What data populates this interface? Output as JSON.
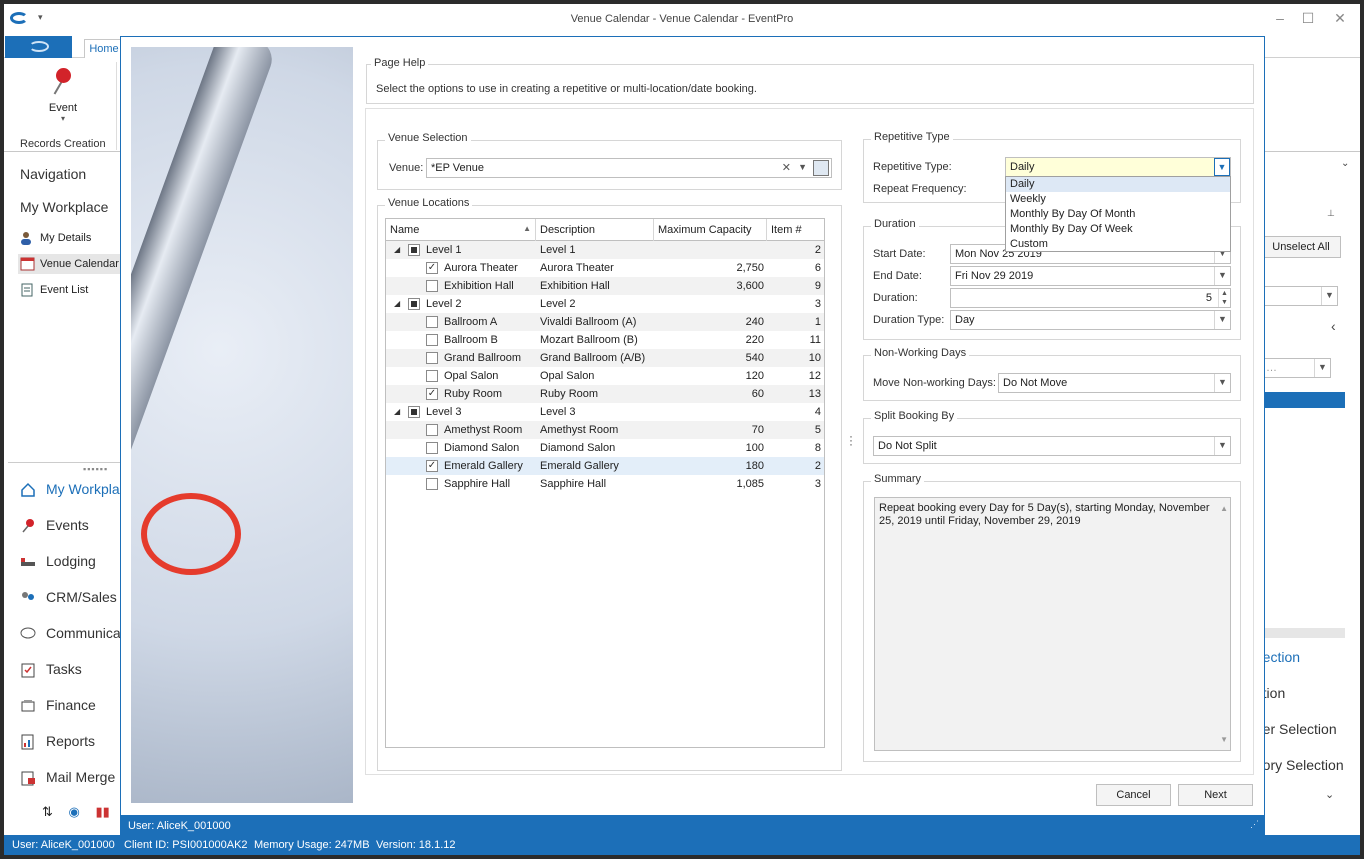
{
  "window": {
    "title": "Venue Calendar - Venue Calendar - EventPro"
  },
  "ribbon": {
    "tabs": [
      "Home"
    ],
    "event_label": "Event",
    "group_label": "Records Creation"
  },
  "nav": {
    "navigation_header": "Navigation",
    "workplace_header": "My Workplace",
    "items": [
      "My Details",
      "Venue Calendar",
      "Event List"
    ],
    "modules": [
      "My Workplace",
      "Events",
      "Lodging",
      "CRM/Sales",
      "Communications",
      "Tasks",
      "Finance",
      "Reports",
      "Mail Merge"
    ]
  },
  "right_panel": {
    "unselect_all": "Unselect All",
    "items": [
      "...ection",
      "...tion",
      "...er Selection",
      "...ory Selection"
    ]
  },
  "status": {
    "user": "User: AliceK_001000",
    "client": "Client ID: PSI001000AK2",
    "memory": "Memory Usage: 247MB",
    "version": "Version: 18.1.12"
  },
  "dialog": {
    "status_user": "User: AliceK_001000",
    "page_help": {
      "title": "Page Help",
      "text": "Select the options to use in creating a repetitive or multi-location/date booking."
    },
    "venue_selection": {
      "title": "Venue Selection",
      "venue_label": "Venue:",
      "venue_value": "*EP Venue"
    },
    "venue_locations": {
      "title": "Venue Locations",
      "columns": [
        "Name",
        "Description",
        "Maximum Capacity",
        "Item #"
      ],
      "rows": [
        {
          "level": 0,
          "name": "Level 1",
          "desc": "Level 1",
          "cap": "",
          "item": "2",
          "check": "ind"
        },
        {
          "level": 1,
          "name": "Aurora Theater",
          "desc": "Aurora Theater",
          "cap": "2,750",
          "item": "6",
          "check": "on"
        },
        {
          "level": 1,
          "name": "Exhibition Hall",
          "desc": "Exhibition Hall",
          "cap": "3,600",
          "item": "9",
          "check": "off"
        },
        {
          "level": 0,
          "name": "Level 2",
          "desc": "Level 2",
          "cap": "",
          "item": "3",
          "check": "ind"
        },
        {
          "level": 1,
          "name": "Ballroom A",
          "desc": "Vivaldi Ballroom (A)",
          "cap": "240",
          "item": "1",
          "check": "off"
        },
        {
          "level": 1,
          "name": "Ballroom B",
          "desc": "Mozart Ballroom (B)",
          "cap": "220",
          "item": "11",
          "check": "off"
        },
        {
          "level": 1,
          "name": "Grand Ballroom",
          "desc": "Grand Ballroom (A/B)",
          "cap": "540",
          "item": "10",
          "check": "off"
        },
        {
          "level": 1,
          "name": "Opal Salon",
          "desc": "Opal Salon",
          "cap": "120",
          "item": "12",
          "check": "off"
        },
        {
          "level": 1,
          "name": "Ruby Room",
          "desc": "Ruby Room",
          "cap": "60",
          "item": "13",
          "check": "on"
        },
        {
          "level": 0,
          "name": "Level 3",
          "desc": "Level 3",
          "cap": "",
          "item": "4",
          "check": "ind"
        },
        {
          "level": 1,
          "name": "Amethyst Room",
          "desc": "Amethyst Room",
          "cap": "70",
          "item": "5",
          "check": "off"
        },
        {
          "level": 1,
          "name": "Diamond Salon",
          "desc": "Diamond Salon",
          "cap": "100",
          "item": "8",
          "check": "off"
        },
        {
          "level": 1,
          "name": "Emerald Gallery",
          "desc": "Emerald Gallery",
          "cap": "180",
          "item": "2",
          "check": "on"
        },
        {
          "level": 1,
          "name": "Sapphire Hall",
          "desc": "Sapphire Hall",
          "cap": "1,085",
          "item": "3",
          "check": "off"
        }
      ]
    },
    "repetitive_type": {
      "title": "Repetitive Type",
      "type_label": "Repetitive Type:",
      "type_value": "Daily",
      "freq_label": "Repeat Frequency:",
      "options": [
        "Daily",
        "Weekly",
        "Monthly By Day Of Month",
        "Monthly By Day Of Week",
        "Custom"
      ]
    },
    "duration": {
      "title": "Duration",
      "start_label": "Start Date:",
      "start_value": "Mon Nov 25 2019",
      "end_label": "End Date:",
      "end_value": "Fri Nov 29 2019",
      "duration_label": "Duration:",
      "duration_value": "5",
      "type_label": "Duration Type:",
      "type_value": "Day"
    },
    "non_working": {
      "title": "Non-Working Days",
      "label": "Move Non-working Days:",
      "value": "Do Not Move"
    },
    "split": {
      "title": "Split Booking By",
      "value": "Do Not Split"
    },
    "summary": {
      "title": "Summary",
      "text": "Repeat booking every Day for 5 Day(s), starting Monday, November 25, 2019 until Friday, November 29, 2019"
    },
    "buttons": {
      "cancel": "Cancel",
      "next": "Next"
    }
  }
}
